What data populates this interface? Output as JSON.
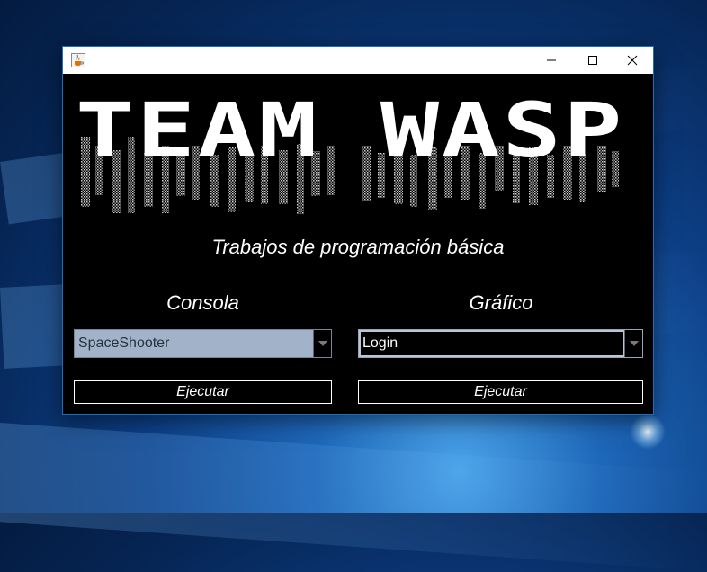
{
  "window": {
    "title": "",
    "icon": "java-cup-icon"
  },
  "logo": {
    "text": "TEAM WASP"
  },
  "subtitle": "Trabajos de programación básica",
  "console": {
    "label": "Consola",
    "selected": "SpaceShooter",
    "button": "Ejecutar"
  },
  "graphic": {
    "label": "Gráfico",
    "selected": "Login",
    "button": "Ejecutar"
  },
  "colors": {
    "window_bg": "#000000",
    "text": "#ffffff",
    "disabled_combo": "#a2b3c9",
    "desktop_blue": "#0d3f86"
  }
}
